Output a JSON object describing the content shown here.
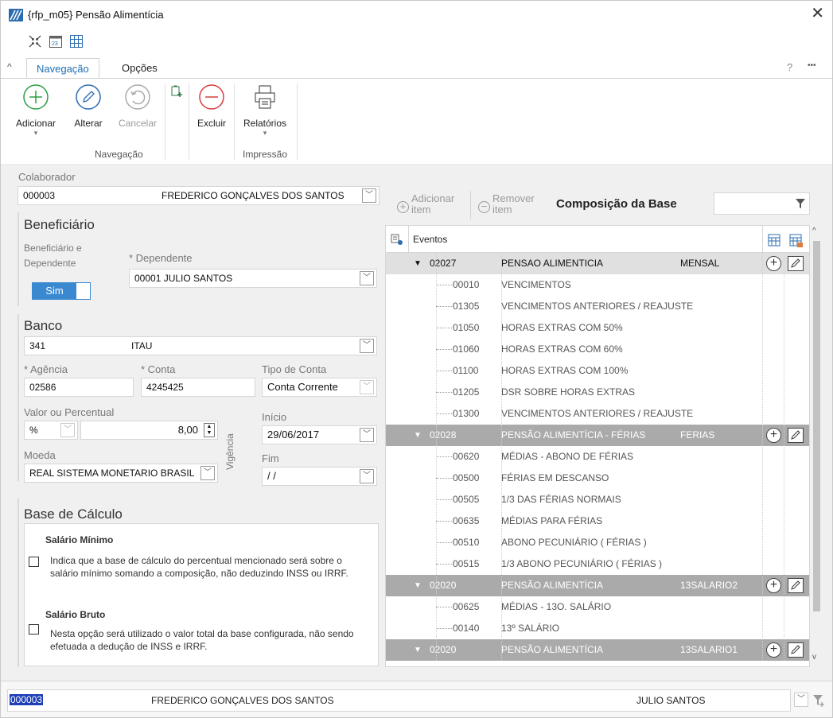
{
  "window": {
    "title": "{rfp_m05}  Pensão Alimentícia"
  },
  "ribbon": {
    "tabs": [
      "Navegação",
      "Opções"
    ],
    "help": "?",
    "more": "•••",
    "buttons": {
      "adicionar": "Adicionar",
      "alterar": "Alterar",
      "cancelar": "Cancelar",
      "excluir": "Excluir",
      "relatorios": "Relatórios"
    },
    "groups": {
      "navegacao": "Navegação",
      "impressao": "Impressão"
    }
  },
  "form": {
    "colaborador_label": "Colaborador",
    "colaborador_code": "000003",
    "colaborador_name": "FREDERICO GONÇALVES DOS SANTOS",
    "beneficiario_title": "Beneficiário",
    "beneficiario_dep_label": "Beneficiário e Dependente",
    "toggle_label": "Sim",
    "dependente_label": "* Dependente",
    "dependente_value": "00001  JULIO SANTOS",
    "banco_title": "Banco",
    "banco_code": "341",
    "banco_name": "ITAU",
    "agencia_label": "* Agência",
    "agencia_value": "02586",
    "conta_label": "* Conta",
    "conta_value": "4245425",
    "tipo_conta_label": "Tipo de Conta",
    "tipo_conta_value": "Conta Corrente",
    "valor_label": "Valor ou Percentual",
    "valor_tipo": "%",
    "valor_value": "8,00",
    "vigencia_label": "Vigência",
    "inicio_label": "Início",
    "inicio_value": "29/06/2017",
    "fim_label": "Fim",
    "fim_value": " /  /",
    "moeda_label": "Moeda",
    "moeda_value": "REAL   SISTEMA MONETARIO BRASIL",
    "base_title": "Base de Cálculo",
    "salario_minimo_title": "Salário Mínimo",
    "salario_minimo_desc": "Indica que a base de cálculo do percentual mencionado será sobre o salário mínimo somando a composição, não deduzindo INSS ou IRRF.",
    "salario_bruto_title": "Salário Bruto",
    "salario_bruto_desc": "Nesta opção será utilizado o valor total da base configurada, não sendo efetuada a dedução  de INSS e IRRF."
  },
  "grid": {
    "add_item": "Adicionar item",
    "remove_item": "Remover item",
    "title": "Composição da Base",
    "column_eventos": "Eventos",
    "groups": [
      {
        "code": "02027",
        "desc": "PENSAO ALIMENTICIA",
        "tipo": "MENSAL",
        "style": "g1",
        "items": [
          {
            "code": "00010",
            "desc": "VENCIMENTOS"
          },
          {
            "code": "01305",
            "desc": "VENCIMENTOS ANTERIORES / REAJUSTE"
          },
          {
            "code": "01050",
            "desc": "HORAS EXTRAS COM 50%"
          },
          {
            "code": "01060",
            "desc": "HORAS EXTRAS COM 60%"
          },
          {
            "code": "01100",
            "desc": "HORAS EXTRAS COM 100%"
          },
          {
            "code": "01205",
            "desc": "DSR SOBRE HORAS EXTRAS"
          },
          {
            "code": "01300",
            "desc": "VENCIMENTOS ANTERIORES / REAJUSTE"
          }
        ]
      },
      {
        "code": "02028",
        "desc": "PENSÃO ALIMENTÍCIA - FÉRIAS",
        "tipo": "FERIAS",
        "style": "g2",
        "items": [
          {
            "code": "00620",
            "desc": "MÉDIAS - ABONO DE FÉRIAS"
          },
          {
            "code": "00500",
            "desc": "FÉRIAS EM DESCANSO"
          },
          {
            "code": "00505",
            "desc": "1/3 DAS FÉRIAS NORMAIS"
          },
          {
            "code": "00635",
            "desc": "MÉDIAS PARA FÉRIAS"
          },
          {
            "code": "00510",
            "desc": "ABONO PECUNIÁRIO ( FÉRIAS )"
          },
          {
            "code": "00515",
            "desc": "1/3 ABONO PECUNIÁRIO ( FÉRIAS )"
          }
        ]
      },
      {
        "code": "02020",
        "desc": "PENSÃO ALIMENTÍCIA",
        "tipo": "13SALARIO2",
        "style": "g2",
        "items": [
          {
            "code": "00625",
            "desc": "MÉDIAS - 13O. SALÁRIO"
          },
          {
            "code": "00140",
            "desc": "13º SALÁRIO"
          }
        ]
      },
      {
        "code": "02020",
        "desc": "PENSÃO ALIMENTÍCIA",
        "tipo": "13SALARIO1",
        "style": "g2",
        "items": []
      }
    ]
  },
  "footer": {
    "code": "000003",
    "name": "FREDERICO GONÇALVES DOS SANTOS",
    "dependente": "JULIO SANTOS"
  }
}
